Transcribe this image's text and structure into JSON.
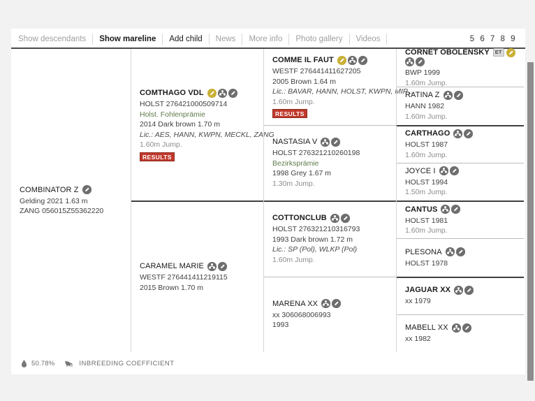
{
  "toolbar": {
    "items": [
      {
        "label": "Show descendants",
        "state": "muted"
      },
      {
        "label": "Show mareline",
        "state": "active"
      },
      {
        "label": "Add child",
        "state": "strong"
      },
      {
        "label": "News",
        "state": "muted"
      },
      {
        "label": "More info",
        "state": "muted"
      },
      {
        "label": "Photo gallery",
        "state": "muted"
      },
      {
        "label": "Videos",
        "state": "muted"
      }
    ],
    "pager": "5 6 7 8 9"
  },
  "pedigree": {
    "subject": {
      "name": "COMBINATOR Z",
      "icons": [
        "pencil-icon"
      ],
      "lines": [
        {
          "text": "Gelding 2021 1.63 m",
          "style": "plain"
        },
        {
          "text": "ZANG 056015Z55362220",
          "style": "plain"
        }
      ]
    },
    "gen2": [
      {
        "name": "COMTHAGO VDL",
        "bold": true,
        "icons": [
          "pencil-gold-icon",
          "pedigree-tree-icon",
          "pencil-icon"
        ],
        "lines": [
          {
            "text": "HOLST 276421000509714",
            "style": "plain"
          },
          {
            "text": "Holst. Fohlenprämie",
            "style": "green"
          },
          {
            "text": "2014 Dark brown 1.70 m",
            "style": "plain"
          },
          {
            "text": "Lic.: AES, HANN, KWPN, MECKL, ZANG",
            "style": "ital"
          },
          {
            "text": "1.60m Jump.",
            "style": "grey"
          }
        ],
        "results": "RESULTS"
      },
      {
        "name": "CARAMEL MARIE",
        "bold": false,
        "icons": [
          "pedigree-tree-icon",
          "pencil-icon"
        ],
        "lines": [
          {
            "text": "WESTF 276441411219115",
            "style": "plain"
          },
          {
            "text": "2015 Brown 1.70 m",
            "style": "plain"
          }
        ],
        "results": null
      }
    ],
    "gen3": [
      {
        "name": "COMME IL FAUT",
        "bold": true,
        "icons": [
          "pencil-gold-icon",
          "pedigree-tree-icon",
          "pencil-icon"
        ],
        "lines": [
          {
            "text": "WESTF 276441411627205",
            "style": "plain"
          },
          {
            "text": "2005 Brown 1.64 m",
            "style": "plain"
          },
          {
            "text": "Lic.: BAVAR, HANN, HOLST, KWPN, MIP…",
            "style": "ital"
          },
          {
            "text": "1.60m Jump.",
            "style": "grey"
          }
        ],
        "results": "RESULTS"
      },
      {
        "name": "NASTASIA V",
        "bold": false,
        "icons": [
          "pedigree-tree-icon",
          "pencil-icon"
        ],
        "lines": [
          {
            "text": "HOLST 276321210260198",
            "style": "plain"
          },
          {
            "text": "Bezirksprämie",
            "style": "green"
          },
          {
            "text": "1998 Grey 1.67 m",
            "style": "plain"
          },
          {
            "text": "1.30m Jump.",
            "style": "grey"
          }
        ],
        "results": null
      },
      {
        "name": "COTTONCLUB",
        "bold": true,
        "icons": [
          "pedigree-tree-icon",
          "pencil-icon"
        ],
        "lines": [
          {
            "text": "HOLST 276321210316793",
            "style": "plain"
          },
          {
            "text": "1993 Dark brown 1.72 m",
            "style": "plain"
          },
          {
            "text": "Lic.: SP (Pol), WLKP (Pol)",
            "style": "ital"
          },
          {
            "text": "1.60m Jump.",
            "style": "grey"
          }
        ],
        "results": null
      },
      {
        "name": "MARENA XX",
        "bold": false,
        "icons": [
          "pedigree-tree-icon",
          "pencil-icon"
        ],
        "lines": [
          {
            "text": "xx 306068006993",
            "style": "plain"
          },
          {
            "text": "1993",
            "style": "plain"
          }
        ],
        "results": null
      }
    ],
    "gen4": [
      {
        "name": "CORNET OBOLENSKY",
        "bold": true,
        "et": "ET",
        "icons": [
          "pencil-gold-icon",
          "pedigree-tree-icon",
          "pencil-icon"
        ],
        "lines": [
          {
            "text": "BWP 1999",
            "style": "plain"
          },
          {
            "text": "1.60m Jump.",
            "style": "grey"
          }
        ]
      },
      {
        "name": "RATINA Z",
        "bold": false,
        "et": null,
        "icons": [
          "pedigree-tree-icon",
          "pencil-icon"
        ],
        "lines": [
          {
            "text": "HANN 1982",
            "style": "plain"
          },
          {
            "text": "1.60m Jump.",
            "style": "grey"
          }
        ]
      },
      {
        "name": "CARTHAGO",
        "bold": true,
        "et": null,
        "icons": [
          "pedigree-tree-icon",
          "pencil-icon"
        ],
        "lines": [
          {
            "text": "HOLST 1987",
            "style": "plain"
          },
          {
            "text": "1.60m Jump.",
            "style": "grey"
          }
        ]
      },
      {
        "name": "JOYCE I",
        "bold": false,
        "et": null,
        "icons": [
          "pedigree-tree-icon",
          "pencil-icon"
        ],
        "lines": [
          {
            "text": "HOLST 1994",
            "style": "plain"
          },
          {
            "text": "1.50m Jump.",
            "style": "grey"
          }
        ]
      },
      {
        "name": "CANTUS",
        "bold": true,
        "et": null,
        "icons": [
          "pedigree-tree-icon",
          "pencil-icon"
        ],
        "lines": [
          {
            "text": "HOLST 1981",
            "style": "plain"
          },
          {
            "text": "1.60m Jump.",
            "style": "grey"
          }
        ]
      },
      {
        "name": "PLESONA",
        "bold": false,
        "et": null,
        "icons": [
          "pedigree-tree-icon",
          "pencil-icon"
        ],
        "lines": [
          {
            "text": "HOLST 1978",
            "style": "plain"
          }
        ]
      },
      {
        "name": "JAGUAR XX",
        "bold": true,
        "et": null,
        "icons": [
          "pedigree-tree-icon",
          "pencil-icon"
        ],
        "lines": [
          {
            "text": "xx 1979",
            "style": "plain"
          }
        ]
      },
      {
        "name": "MABELL XX",
        "bold": false,
        "et": null,
        "icons": [
          "pedigree-tree-icon",
          "pencil-icon"
        ],
        "lines": [
          {
            "text": "xx 1982",
            "style": "plain"
          }
        ]
      }
    ]
  },
  "footer": {
    "blood_icon": "blood-drop-icon",
    "percent": "50.78%",
    "horse_icon": "horse-icon",
    "label": "INBREEDING COEFFICIENT"
  },
  "colors": {
    "accent_gold": "#c9b037",
    "results_red": "#c0392b",
    "premium_green": "#5f7a4a",
    "icon_grey": "#6e6e6e"
  }
}
